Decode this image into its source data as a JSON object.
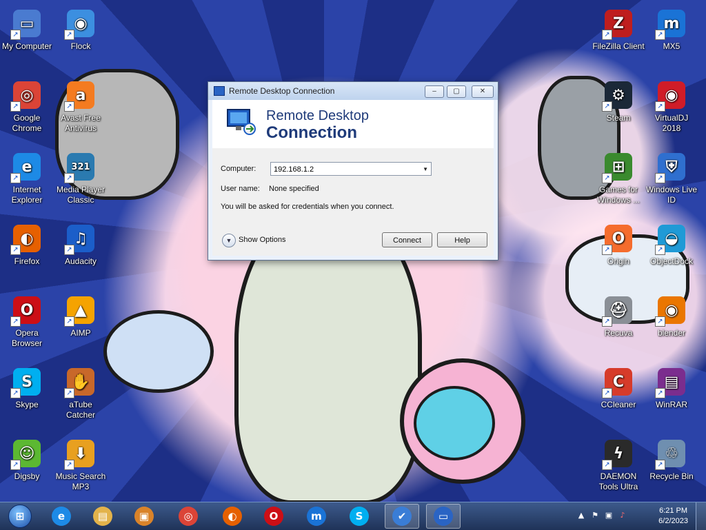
{
  "desktop": {
    "icons": [
      {
        "label": "My Computer",
        "icon": "computer-icon",
        "color": "#4a7bd0",
        "glyph": "▭"
      },
      {
        "label": "Flock",
        "icon": "flock-icon",
        "color": "#3c8fe0",
        "glyph": "◉"
      },
      {
        "label": "Google Chrome",
        "icon": "chrome-icon",
        "color": "#db4437",
        "glyph": "◎"
      },
      {
        "label": "Avast Free Antivirus",
        "icon": "avast-icon",
        "color": "#f47b20",
        "glyph": "a"
      },
      {
        "label": "Internet Explorer",
        "icon": "ie-icon",
        "color": "#1d8ae6",
        "glyph": "e"
      },
      {
        "label": "Media Player Classic",
        "icon": "mpc-icon",
        "color": "#2a7ab0",
        "glyph": "321"
      },
      {
        "label": "Firefox",
        "icon": "firefox-icon",
        "color": "#e66000",
        "glyph": "◐"
      },
      {
        "label": "Audacity",
        "icon": "audacity-icon",
        "color": "#1b5ec9",
        "glyph": "♫"
      },
      {
        "label": "Opera Browser",
        "icon": "opera-icon",
        "color": "#cc0f16",
        "glyph": "O"
      },
      {
        "label": "AIMP",
        "icon": "aimp-icon",
        "color": "#f5a300",
        "glyph": "▲"
      },
      {
        "label": "Skype",
        "icon": "skype-icon",
        "color": "#00aff0",
        "glyph": "S"
      },
      {
        "label": "aTube Catcher",
        "icon": "atube-icon",
        "color": "#c8682a",
        "glyph": "✋"
      },
      {
        "label": "Digsby",
        "icon": "digsby-icon",
        "color": "#5cb832",
        "glyph": "☺"
      },
      {
        "label": "Music Search MP3",
        "icon": "music-search-icon",
        "color": "#e8a020",
        "glyph": "⬇"
      },
      {
        "label": "FileZilla Client",
        "icon": "filezilla-icon",
        "color": "#bf1e1e",
        "glyph": "Z"
      },
      {
        "label": "MX5",
        "icon": "maxthon-icon",
        "color": "#1a73d6",
        "glyph": "m"
      },
      {
        "label": "Steam",
        "icon": "steam-icon",
        "color": "#1b2838",
        "glyph": "⚙"
      },
      {
        "label": "VirtualDJ 2018",
        "icon": "virtualdj-icon",
        "color": "#d01c28",
        "glyph": "◉"
      },
      {
        "label": "Games for Windows ...",
        "icon": "games-for-windows-icon",
        "color": "#3a8a2e",
        "glyph": "⊞"
      },
      {
        "label": "Windows Live ID",
        "icon": "windows-live-id-icon",
        "color": "#2f6fcf",
        "glyph": "⛨"
      },
      {
        "label": "Origin",
        "icon": "origin-icon",
        "color": "#f56c2d",
        "glyph": "O"
      },
      {
        "label": "ObjectDock",
        "icon": "objectdock-icon",
        "color": "#1f9ad6",
        "glyph": "◒"
      },
      {
        "label": "Recuva",
        "icon": "recuva-icon",
        "color": "#8a8f96",
        "glyph": "⛑"
      },
      {
        "label": "blender",
        "icon": "blender-icon",
        "color": "#ea7600",
        "glyph": "◉"
      },
      {
        "label": "CCleaner",
        "icon": "ccleaner-icon",
        "color": "#d63b2a",
        "glyph": "C"
      },
      {
        "label": "WinRAR",
        "icon": "winrar-icon",
        "color": "#7b2d8e",
        "glyph": "▤"
      },
      {
        "label": "DAEMON Tools Ultra",
        "icon": "daemon-tools-icon",
        "color": "#2a2a2a",
        "glyph": "ϟ"
      },
      {
        "label": "Recycle Bin",
        "icon": "recycle-bin-icon",
        "color": "#6f8fb0",
        "glyph": "♲"
      }
    ]
  },
  "dialog": {
    "title": "Remote Desktop Connection",
    "banner_line1": "Remote Desktop",
    "banner_line2": "Connection",
    "computer_label": "Computer:",
    "computer_value": "192.168.1.2",
    "username_label": "User name:",
    "username_value": "None specified",
    "credentials_note": "You will be asked for credentials when you connect.",
    "show_options": "Show Options",
    "connect": "Connect",
    "help": "Help"
  },
  "taskbar": {
    "pinned": [
      {
        "name": "internet-explorer",
        "icon": "ie-icon",
        "color": "#1d8ae6",
        "glyph": "e"
      },
      {
        "name": "file-explorer",
        "icon": "folder-icon",
        "color": "#e3b34b",
        "glyph": "▤"
      },
      {
        "name": "unknown-app",
        "icon": "app-icon",
        "color": "#d9832a",
        "glyph": "▣"
      },
      {
        "name": "chrome",
        "icon": "chrome-icon",
        "color": "#db4437",
        "glyph": "◎"
      },
      {
        "name": "firefox",
        "icon": "firefox-icon",
        "color": "#e66000",
        "glyph": "◐"
      },
      {
        "name": "opera",
        "icon": "opera-icon",
        "color": "#cc0f16",
        "glyph": "O"
      },
      {
        "name": "maxthon",
        "icon": "maxthon-icon",
        "color": "#1a73d6",
        "glyph": "m"
      },
      {
        "name": "skype",
        "icon": "skype-icon",
        "color": "#00aff0",
        "glyph": "S"
      },
      {
        "name": "security-tool",
        "icon": "security-icon",
        "color": "#3a7dd6",
        "glyph": "✔"
      },
      {
        "name": "remote-desktop",
        "icon": "remote-desktop-icon",
        "color": "#2a64c4",
        "glyph": "▭"
      }
    ],
    "clock_time": "6:21 PM",
    "clock_date": "6/2/2023"
  }
}
